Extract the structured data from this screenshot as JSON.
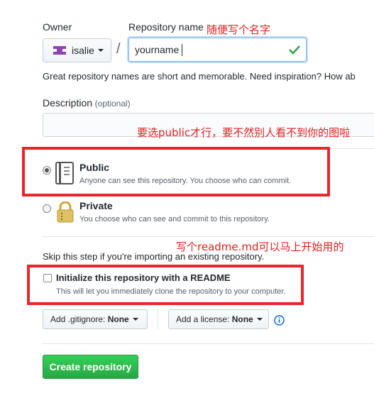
{
  "owner": {
    "label": "Owner",
    "value": "isalie"
  },
  "separator": "/",
  "repo_name": {
    "label": "Repository name",
    "value": "yourname"
  },
  "hint_text": "Great repository names are short and memorable. Need inspiration? How ab",
  "description": {
    "label": "Description",
    "optional": "(optional)",
    "value": ""
  },
  "visibility": {
    "public": {
      "title": "Public",
      "desc": "Anyone can see this repository. You choose who can commit.",
      "selected": true
    },
    "private": {
      "title": "Private",
      "desc": "You choose who can see and commit to this repository.",
      "selected": false
    }
  },
  "skip_text": "Skip this step if you're importing an existing repository.",
  "readme": {
    "label": "Initialize this repository with a README",
    "desc": "This will let you immediately clone the repository to your computer.",
    "checked": false
  },
  "gitignore": {
    "prefix": "Add .gitignore:",
    "value": "None"
  },
  "license": {
    "prefix": "Add a license:",
    "value": "None"
  },
  "create_label": "Create repository",
  "annotations": {
    "name": "随便写个名字",
    "public": "要选public才行，要不然别人看不到你的图啦",
    "readme": "写个readme.md可以马上开始用的"
  },
  "colors": {
    "annotation": "#e02020",
    "create_button": "#2cbe4e",
    "valid_check": "#28a745"
  }
}
